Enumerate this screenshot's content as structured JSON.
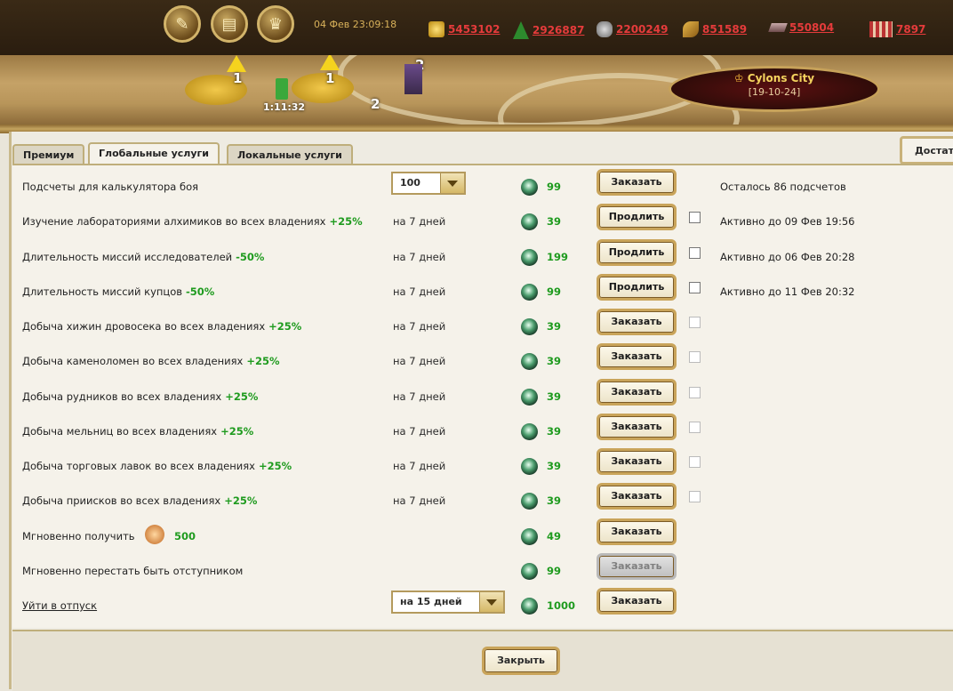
{
  "header": {
    "datetime": "04 Фев 23:09:18",
    "resources": [
      {
        "icon": "gold-coins-icon",
        "value": "5453102"
      },
      {
        "icon": "tree-icon",
        "value": "2926887"
      },
      {
        "icon": "stone-icon",
        "value": "2200249"
      },
      {
        "icon": "wheat-icon",
        "value": "851589"
      },
      {
        "icon": "ingot-icon",
        "value": "550804"
      },
      {
        "icon": "population-icon",
        "value": "7897"
      }
    ]
  },
  "map": {
    "camp1_count": "1",
    "camp2_count": "1",
    "unit_top_count": "2",
    "unit_bottom_count": "2",
    "timer": "1:11:32",
    "city_name": "Cylons City",
    "city_coords": "[19-10-24]"
  },
  "tabs": [
    "Премиум",
    "Глобальные услуги",
    "Локальные услуги"
  ],
  "right_tab": "Достат",
  "services": [
    {
      "name": "Подсчеты для калькулятора боя",
      "bonus": "",
      "select": "100",
      "price": "99",
      "button": "Заказать",
      "status": "Осталось 86 подсчетов"
    },
    {
      "name": "Изучение лабораториями алхимиков во всех владениях",
      "bonus": "+25%",
      "duration": "на 7 дней",
      "price": "39",
      "button": "Продлить",
      "status": "Активно до 09 Фев 19:56"
    },
    {
      "name": "Длительность миссий исследователей",
      "bonus": "-50%",
      "duration": "на 7 дней",
      "price": "199",
      "button": "Продлить",
      "status": "Активно до 06 Фев 20:28"
    },
    {
      "name": "Длительность миссий купцов",
      "bonus": "-50%",
      "duration": "на 7 дней",
      "price": "99",
      "button": "Продлить",
      "status": "Активно до 11 Фев 20:32"
    },
    {
      "name": "Добыча хижин дровосека во всех владениях",
      "bonus": "+25%",
      "duration": "на 7 дней",
      "price": "39",
      "button": "Заказать",
      "status": ""
    },
    {
      "name": "Добыча каменоломен во всех владениях",
      "bonus": "+25%",
      "duration": "на 7 дней",
      "price": "39",
      "button": "Заказать",
      "status": ""
    },
    {
      "name": "Добыча рудников во всех владениях",
      "bonus": "+25%",
      "duration": "на 7 дней",
      "price": "39",
      "button": "Заказать",
      "status": ""
    },
    {
      "name": "Добыча мельниц во всех владениях",
      "bonus": "+25%",
      "duration": "на 7 дней",
      "price": "39",
      "button": "Заказать",
      "status": ""
    },
    {
      "name": "Добыча торговых лавок во всех владениях",
      "bonus": "+25%",
      "duration": "на 7 дней",
      "price": "39",
      "button": "Заказать",
      "status": ""
    },
    {
      "name": "Добыча приисков во всех владениях",
      "bonus": "+25%",
      "duration": "на 7 дней",
      "price": "39",
      "button": "Заказать",
      "status": ""
    },
    {
      "name": "Мгновенно получить",
      "bonus": "500",
      "price": "49",
      "button": "Заказать",
      "status": ""
    },
    {
      "name": "Мгновенно перестать быть отступником",
      "bonus": "",
      "price": "99",
      "button": "Заказать",
      "status": ""
    },
    {
      "name": "Уйти в отпуск",
      "bonus": "",
      "select": "на 15 дней",
      "price": "1000",
      "button": "Заказать",
      "status": ""
    }
  ],
  "close_label": "Закрыть"
}
